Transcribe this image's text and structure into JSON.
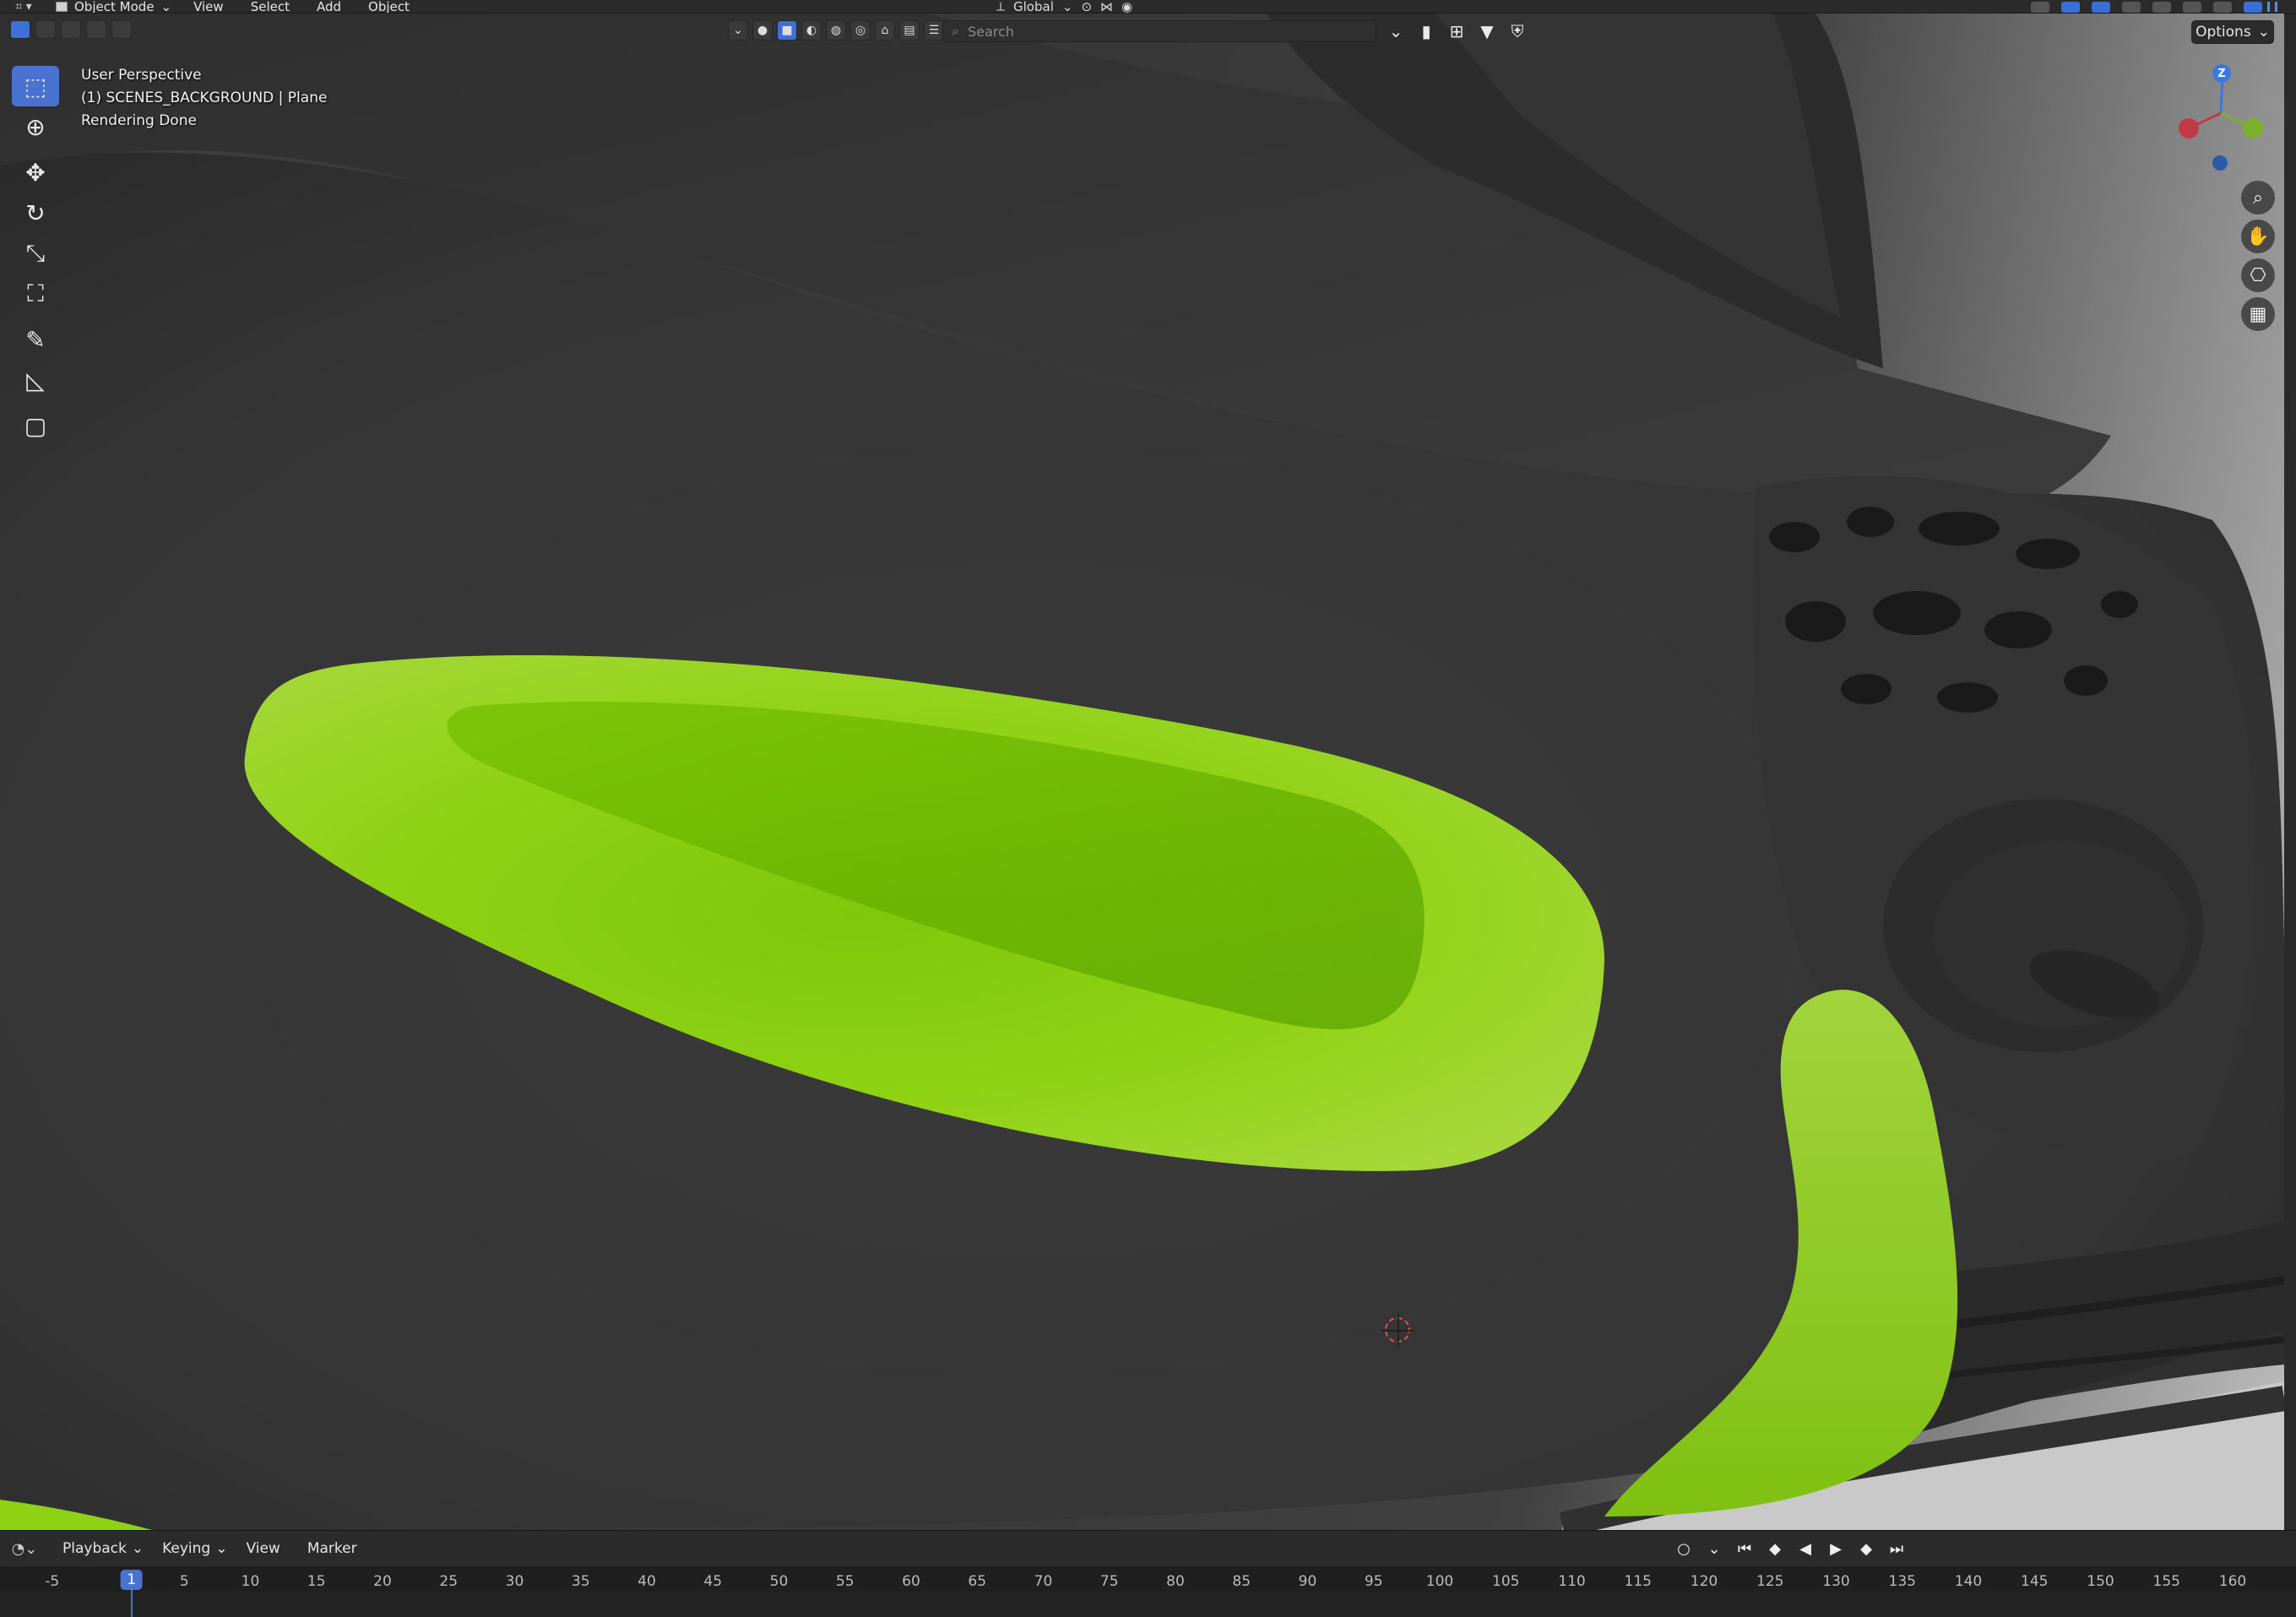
{
  "header": {
    "mode": "Object Mode",
    "menus": [
      "View",
      "Select",
      "Add",
      "Object"
    ],
    "transform_orientation": "Global"
  },
  "viewport": {
    "search_placeholder": "Search",
    "options_label": "Options",
    "info": {
      "perspective": "User Perspective",
      "object": "(1) SCENES_BACKGROUND | Plane",
      "status": "Rendering Done"
    },
    "gizmo": {
      "z_label": "Z"
    }
  },
  "timeline": {
    "menus": [
      "Playback",
      "Keying",
      "View",
      "Marker"
    ],
    "current_frame": "1",
    "ticks": [
      "-5",
      "5",
      "10",
      "15",
      "20",
      "25",
      "30",
      "35",
      "40",
      "45",
      "50",
      "55",
      "60",
      "65",
      "70",
      "75",
      "80",
      "85",
      "90",
      "95",
      "100",
      "105",
      "110",
      "115",
      "120",
      "125",
      "130",
      "135",
      "140",
      "145",
      "150",
      "155",
      "160"
    ]
  },
  "colors": {
    "accent": "#4a73d1",
    "lime": "#8fd400",
    "shoe_dark": "#3a3a3a"
  },
  "icons": {
    "tools": [
      "select-box-icon",
      "cursor-icon",
      "move-icon",
      "rotate-icon",
      "scale-icon",
      "transform-icon",
      "annotate-icon",
      "measure-icon",
      "add-cube-icon"
    ]
  }
}
